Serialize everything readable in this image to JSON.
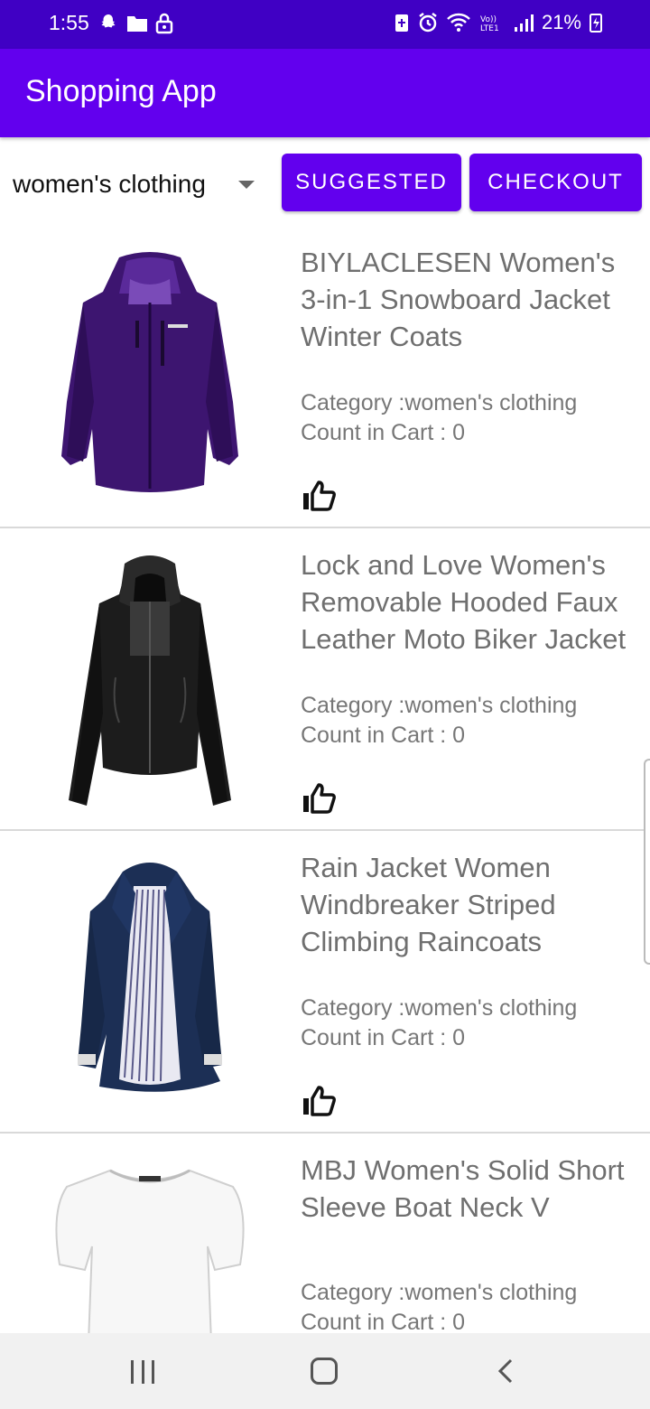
{
  "status_bar": {
    "time": "1:55",
    "battery": "21%",
    "left_icons": [
      "snapchat-icon",
      "folder-icon",
      "lock-icon"
    ],
    "right_icons": [
      "battery-saver-icon",
      "alarm-icon",
      "wifi-icon",
      "volte-icon",
      "signal-icon",
      "charging-icon"
    ]
  },
  "app_bar": {
    "title": "Shopping App"
  },
  "controls": {
    "category_selected": "women's clothing",
    "suggested_label": "SUGGESTED",
    "checkout_label": "CHECKOUT"
  },
  "products": [
    {
      "title": "BIYLACLESEN Women's 3-in-1 Snowboard Jacket Winter Coats",
      "category": "Category :women's clothing",
      "count": "Count in Cart : 0",
      "image": "purple-jacket"
    },
    {
      "title": "Lock and Love Women's Removable Hooded Faux Leather Moto Biker Jacket",
      "category": "Category :women's clothing",
      "count": "Count in Cart : 0",
      "image": "black-leather-jacket"
    },
    {
      "title": "Rain Jacket Women Windbreaker Striped Climbing Raincoats",
      "category": "Category :women's clothing",
      "count": "Count in Cart : 0",
      "image": "navy-raincoat"
    },
    {
      "title": "MBJ Women's Solid Short Sleeve Boat Neck V",
      "category": "Category :women's clothing",
      "count": "Count in Cart : 0",
      "image": "white-tshirt"
    }
  ],
  "colors": {
    "status_bar": "#4000c4",
    "app_bar": "#6200ee",
    "button": "#6200ee"
  }
}
